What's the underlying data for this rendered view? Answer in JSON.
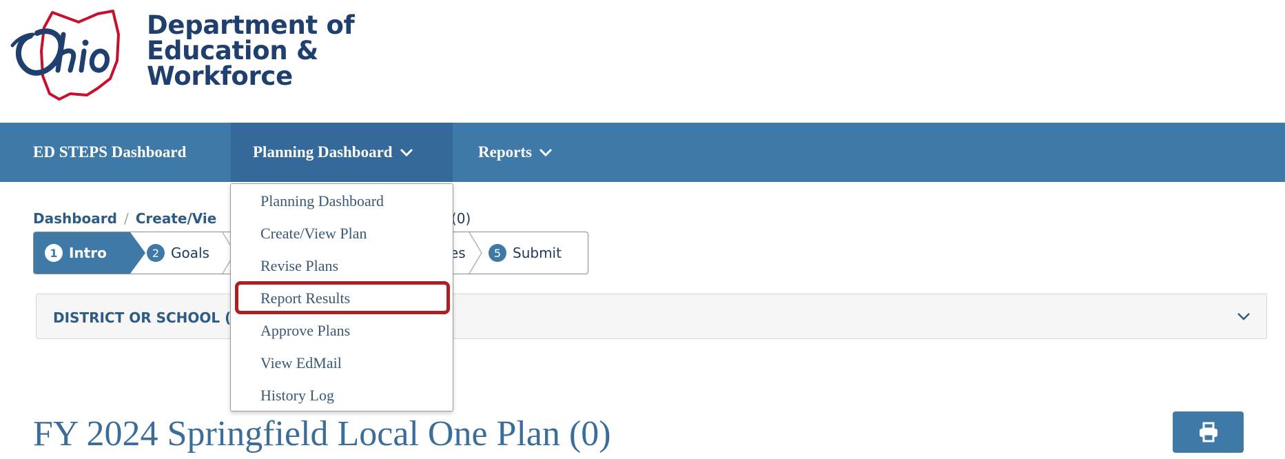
{
  "brand": {
    "logo_text": "Ohio",
    "line1": "Department of",
    "line2": "Education &",
    "line3": "Workforce"
  },
  "nav": {
    "items": [
      {
        "label": "ED STEPS Dashboard"
      },
      {
        "label": "Planning Dashboard"
      },
      {
        "label": "Reports"
      }
    ]
  },
  "breadcrumb": {
    "items": [
      "Dashboard",
      "Create/Vie"
    ],
    "separator": "/",
    "tail": "(0)"
  },
  "stepper": {
    "steps": [
      {
        "num": "1",
        "label": "Intro"
      },
      {
        "num": "2",
        "label": "Goals"
      },
      {
        "num": "",
        "label": "es"
      },
      {
        "num": "5",
        "label": "Submit"
      }
    ]
  },
  "accordion": {
    "title": "DISTRICT OR SCHOOL ("
  },
  "page": {
    "title": "FY 2024 Springfield Local One Plan (0)"
  },
  "dropdown": {
    "items": [
      "Planning Dashboard",
      "Create/View Plan",
      "Revise Plans",
      "Report Results",
      "Approve Plans",
      "View EdMail",
      "History Log"
    ],
    "highlighted": "Report Results"
  },
  "colors": {
    "nav_bg": "#3f79a7",
    "brand_text": "#1f3f6e",
    "logo_red": "#c8102e",
    "highlight": "#b01e23"
  }
}
